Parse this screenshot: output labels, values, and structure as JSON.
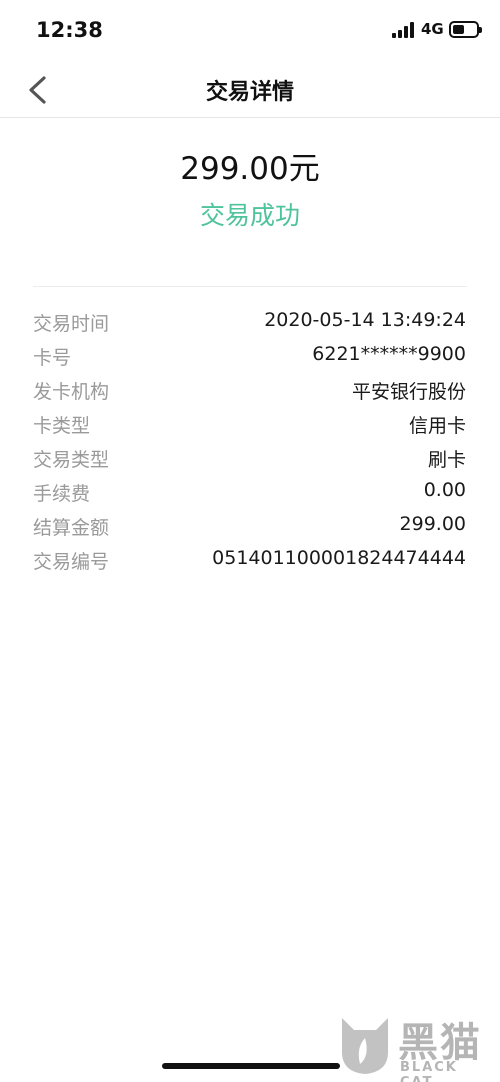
{
  "status_bar": {
    "time": "12:38",
    "network": "4G",
    "signal_icon": "signal-bars-icon",
    "battery_icon": "battery-icon"
  },
  "nav": {
    "back_icon": "chevron-left-icon",
    "title": "交易详情"
  },
  "summary": {
    "amount": "299.00元",
    "status": "交易成功",
    "status_color": "#4fc39b"
  },
  "details": [
    {
      "label": "交易时间",
      "value": "2020-05-14 13:49:24"
    },
    {
      "label": "卡号",
      "value": "6221******9900"
    },
    {
      "label": "发卡机构",
      "value": "平安银行股份"
    },
    {
      "label": "卡类型",
      "value": "信用卡"
    },
    {
      "label": "交易类型",
      "value": "刷卡"
    },
    {
      "label": "手续费",
      "value": "0.00"
    },
    {
      "label": "结算金额",
      "value": "299.00"
    },
    {
      "label": "交易编号",
      "value": "051401100001824474444"
    }
  ],
  "watermark": {
    "text": "黑猫",
    "subtext": "BLACK CAT"
  }
}
